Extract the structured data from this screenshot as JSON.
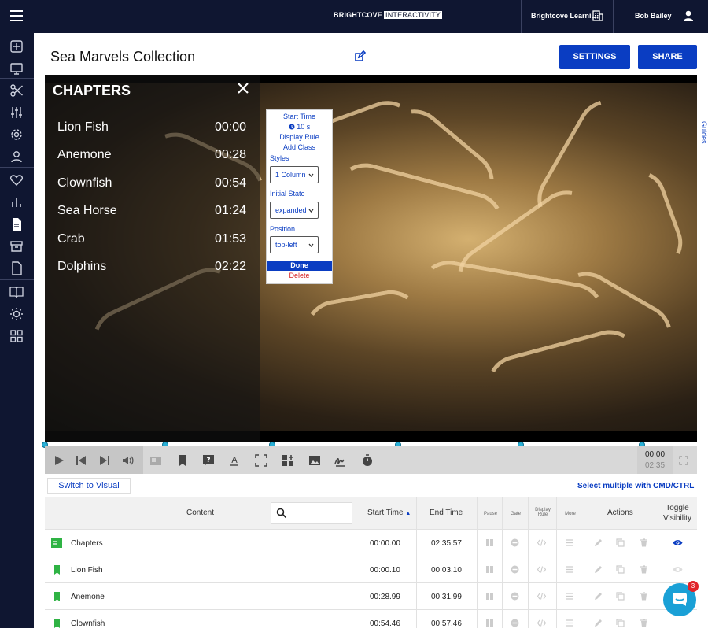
{
  "topbar": {
    "brand_left": "BRIGHTCOVE",
    "brand_right": "INTERACTIVITY",
    "account": "Brightcove Learni...",
    "user": "Bob Bailey"
  },
  "header": {
    "title": "Sea Marvels Collection",
    "settings_label": "SETTINGS",
    "share_label": "SHARE"
  },
  "chapters": {
    "title": "CHAPTERS",
    "items": [
      {
        "label": "Lion Fish",
        "time": "00:00"
      },
      {
        "label": "Anemone",
        "time": "00:28"
      },
      {
        "label": "Clownfish",
        "time": "00:54"
      },
      {
        "label": "Sea Horse",
        "time": "01:24"
      },
      {
        "label": "Crab",
        "time": "01:53"
      },
      {
        "label": "Dolphins",
        "time": "02:22"
      }
    ]
  },
  "popup": {
    "start_time": "Start Time",
    "duration": "10 s",
    "display_rule": "Display Rule",
    "add_class": "Add Class",
    "styles_label": "Styles",
    "styles_value": "1 Column",
    "initial_state_label": "Initial State",
    "initial_state_value": "expanded",
    "position_label": "Position",
    "position_value": "top-left",
    "done": "Done",
    "delete": "Delete"
  },
  "player": {
    "current_time": "00:00",
    "duration": "02:35"
  },
  "table": {
    "switch_label": "Switch to Visual View",
    "multi_select": "Select multiple with CMD/CTRL",
    "columns": {
      "content": "Content",
      "start": "Start Time",
      "end": "End Time",
      "pause": "Pause",
      "gate": "Gate",
      "display_rule_1": "Display",
      "display_rule_2": "Rule",
      "more": "More",
      "actions": "Actions",
      "toggle_1": "Toggle",
      "toggle_2": "Visibility"
    },
    "rows": [
      {
        "name": "Chapters",
        "start": "00:00.00",
        "end": "02:35.57"
      },
      {
        "name": "Lion Fish",
        "start": "00:00.10",
        "end": "00:03.10"
      },
      {
        "name": "Anemone",
        "start": "00:28.99",
        "end": "00:31.99"
      },
      {
        "name": "Clownfish",
        "start": "00:54.46",
        "end": "00:57.46"
      }
    ]
  },
  "guides": "Guides",
  "chat": {
    "badge": "3"
  },
  "colors": {
    "accent": "#0a3dc2",
    "nav": "#0f1631",
    "success": "#2fb344",
    "danger": "#d62020"
  }
}
